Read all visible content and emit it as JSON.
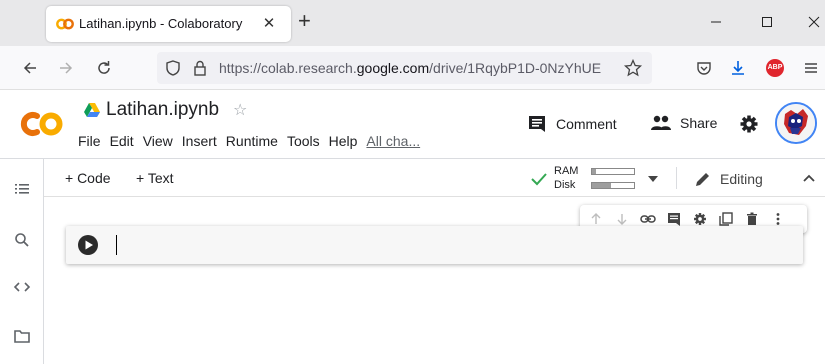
{
  "browser": {
    "tab_title": "Latihan.ipynb - Colaboratory",
    "tab_close": "✕",
    "new_tab": "+",
    "url_prefix": "https://colab.research.",
    "url_domain": "google.com",
    "url_suffix": "/drive/1RqybP1D-0NzYhUE",
    "abp_label": "ABP"
  },
  "colab": {
    "logo_text": "CO",
    "notebook_title": "Latihan.ipynb",
    "menu": [
      "File",
      "Edit",
      "View",
      "Insert",
      "Runtime",
      "Tools",
      "Help",
      "All cha..."
    ],
    "comment_label": "Comment",
    "share_label": "Share"
  },
  "toolbar": {
    "add_code": "+ Code",
    "add_text": "+ Text",
    "ram_label": "RAM",
    "disk_label": "Disk",
    "ram_usage": 0.1,
    "disk_usage": 0.45,
    "editing_label": "Editing"
  },
  "colors": {
    "colab_orange": "#f9ab00",
    "connected_green": "#34a853",
    "abp_red": "#e0262e"
  }
}
